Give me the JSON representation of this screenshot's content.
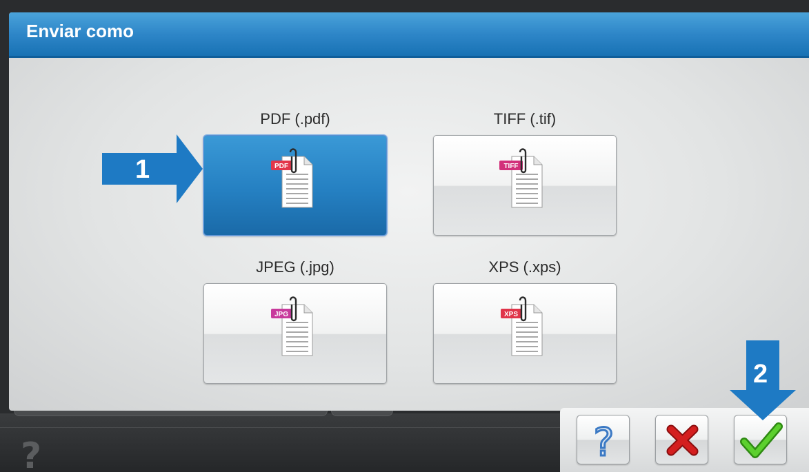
{
  "dialog": {
    "title": "Enviar como"
  },
  "formats": [
    {
      "label": "PDF (.pdf)",
      "badge": "PDF",
      "badge_color": "#e3364a",
      "selected": true
    },
    {
      "label": "TIFF (.tif)",
      "badge": "TIFF",
      "badge_color": "#d2307a",
      "selected": false
    },
    {
      "label": "JPEG (.jpg)",
      "badge": "JPG",
      "badge_color": "#c83a9c",
      "selected": false
    },
    {
      "label": "XPS (.xps)",
      "badge": "XPS",
      "badge_color": "#e0344a",
      "selected": false
    }
  ],
  "steps": {
    "first": "1",
    "second": "2"
  },
  "actions": {
    "help_icon": "question-mark-icon",
    "cancel_icon": "red-x-icon",
    "confirm_icon": "green-check-icon"
  },
  "background": {
    "question_glyph": "?"
  },
  "colors": {
    "title_bar": "#2e86c8",
    "selected_button": "#2580c2",
    "step_arrow": "#1e7ac4",
    "cancel": "#d41e1e",
    "confirm": "#4cbc22"
  }
}
